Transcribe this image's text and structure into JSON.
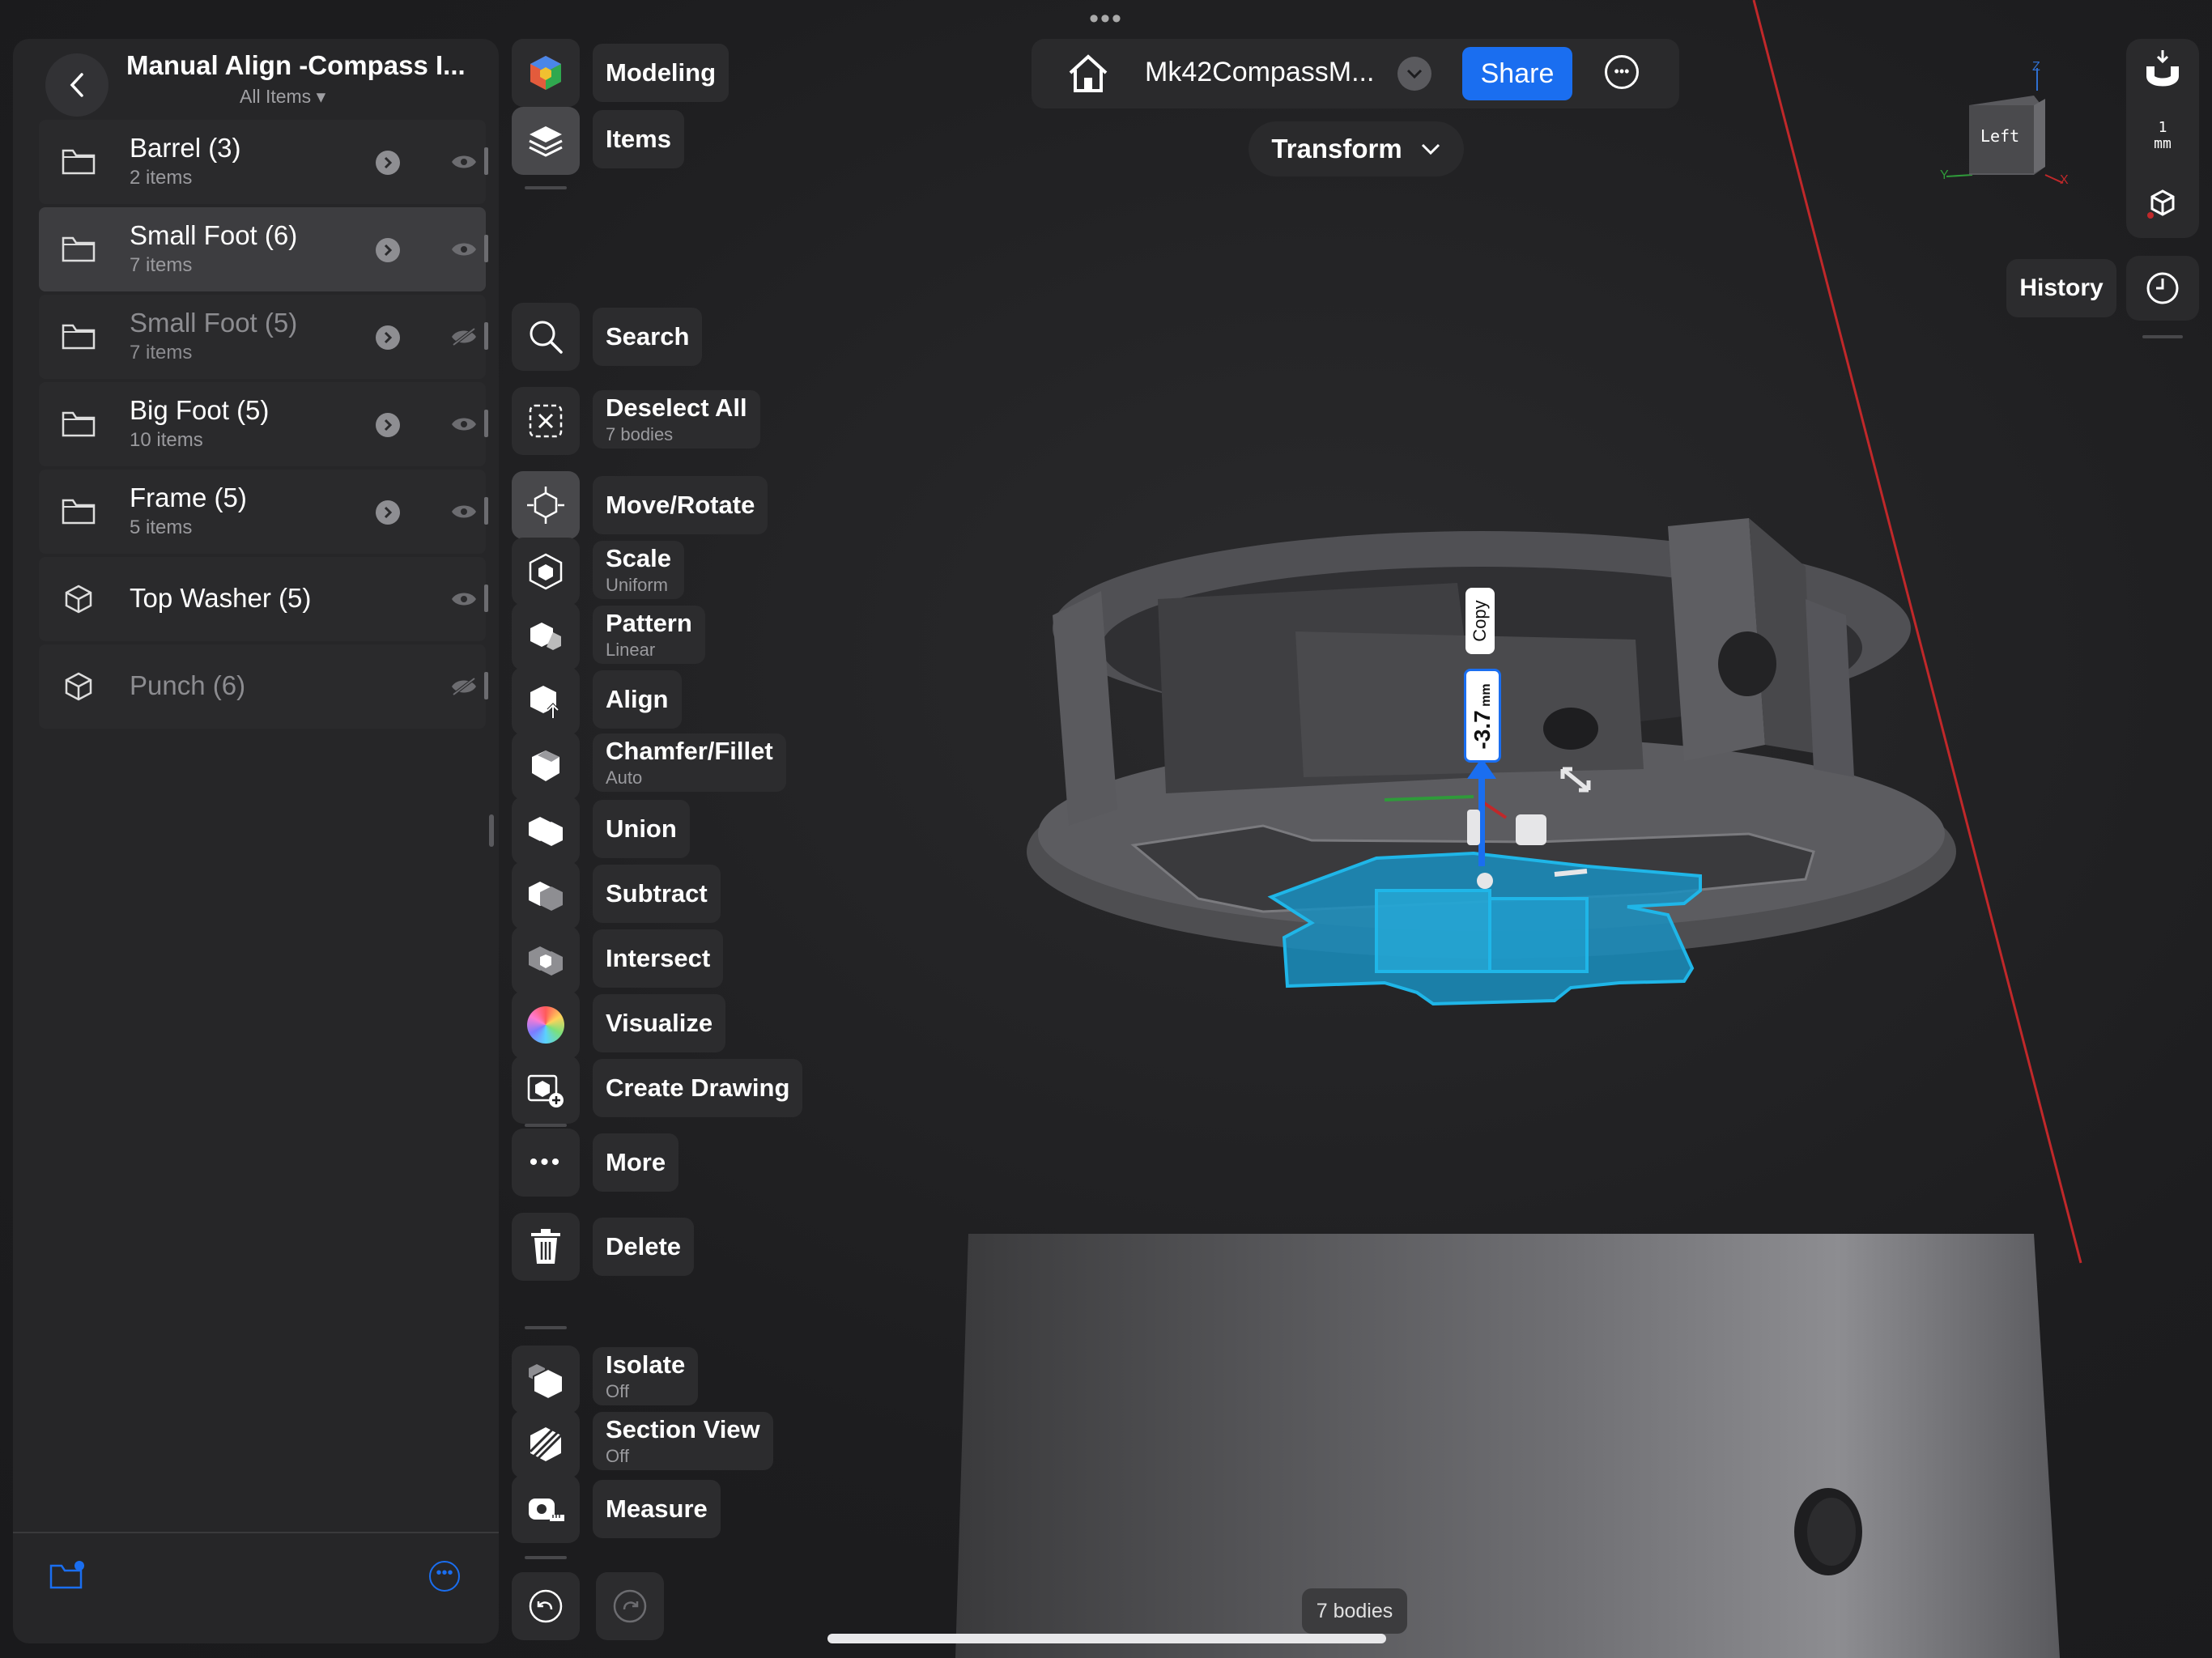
{
  "top_handle": "•••",
  "left_panel": {
    "title": "Manual Align -Compass I...",
    "subtitle": "All Items ▾",
    "items": [
      {
        "name": "Barrel (3)",
        "count": "2 items",
        "type": "folder",
        "hidden": false,
        "selected": false
      },
      {
        "name": "Small Foot (6)",
        "count": "7 items",
        "type": "folder",
        "hidden": false,
        "selected": true
      },
      {
        "name": "Small Foot (5)",
        "count": "7 items",
        "type": "folder",
        "hidden": true,
        "selected": false
      },
      {
        "name": "Big Foot (5)",
        "count": "10 items",
        "type": "folder",
        "hidden": false,
        "selected": false
      },
      {
        "name": "Frame (5)",
        "count": "5 items",
        "type": "folder",
        "hidden": false,
        "selected": false
      },
      {
        "name": "Top Washer (5)",
        "count": "",
        "type": "body",
        "hidden": false,
        "selected": false
      },
      {
        "name": "Punch (6)",
        "count": "",
        "type": "body",
        "hidden": true,
        "selected": false
      }
    ]
  },
  "toolbar": {
    "modeling": "Modeling",
    "items": "Items",
    "search": "Search",
    "deselect_all": "Deselect All",
    "deselect_sub": "7 bodies",
    "move_rotate": "Move/Rotate",
    "scale": "Scale",
    "scale_sub": "Uniform",
    "pattern": "Pattern",
    "pattern_sub": "Linear",
    "align": "Align",
    "chamfer": "Chamfer/Fillet",
    "chamfer_sub": "Auto",
    "union": "Union",
    "subtract": "Subtract",
    "intersect": "Intersect",
    "visualize": "Visualize",
    "create_drawing": "Create Drawing",
    "more": "More",
    "delete": "Delete",
    "isolate": "Isolate",
    "isolate_sub": "Off",
    "section_view": "Section View",
    "section_sub": "Off",
    "measure": "Measure"
  },
  "topbar": {
    "doc_name": "Mk42CompassM...",
    "share": "Share"
  },
  "transform_menu": "Transform",
  "view_cube": {
    "face": "Left",
    "axis_z": "Z",
    "axis_y": "Y",
    "axis_x": "X"
  },
  "units": {
    "value": "1",
    "unit": "mm"
  },
  "history": "History",
  "viewport": {
    "copy_tag": "Copy",
    "dimension_value": "-3.7",
    "dimension_unit": "mm",
    "bodies_count": "7 bodies"
  },
  "colors": {
    "accent": "#1a6ef0",
    "selection": "#1fb6e8",
    "axis_red": "#c0282a"
  }
}
